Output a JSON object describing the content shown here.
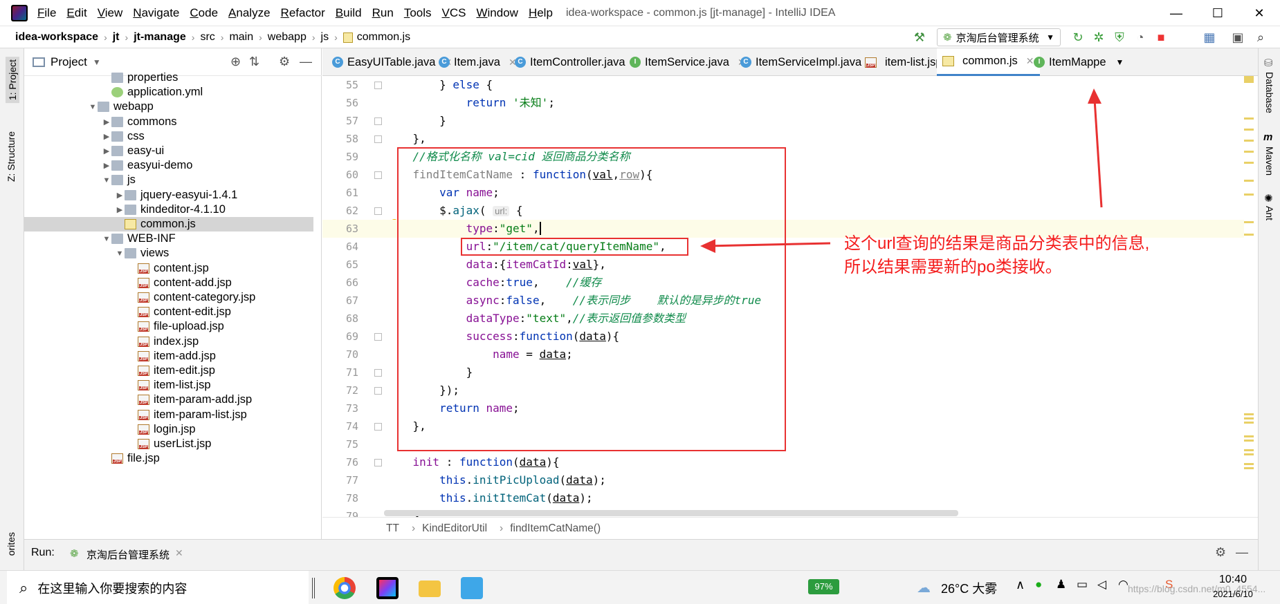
{
  "window": {
    "title": "idea-workspace - common.js [jt-manage] - IntelliJ IDEA",
    "menu": [
      "File",
      "Edit",
      "View",
      "Navigate",
      "Code",
      "Analyze",
      "Refactor",
      "Build",
      "Run",
      "Tools",
      "VCS",
      "Window",
      "Help"
    ],
    "controls": {
      "minimize": "—",
      "maximize": "☐",
      "close": "✕"
    }
  },
  "breadcrumb": [
    "idea-workspace",
    "jt",
    "jt-manage",
    "src",
    "main",
    "webapp",
    "js",
    "common.js"
  ],
  "run_config": "京淘后台管理系统",
  "left_strip": {
    "project": "1: Project",
    "structure": "Z: Structure",
    "favorites": "orites"
  },
  "right_strip": {
    "database": "Database",
    "maven": "Maven",
    "ant": "Ant"
  },
  "project_panel": {
    "title": "Project",
    "items": [
      {
        "label": "properties",
        "type": "folder",
        "indent": 1,
        "arrow": ""
      },
      {
        "label": "application.yml",
        "type": "yml",
        "indent": 1,
        "arrow": ""
      },
      {
        "label": "webapp",
        "type": "folder",
        "indent": 0,
        "arrow": "▼"
      },
      {
        "label": "commons",
        "type": "folder",
        "indent": 1,
        "arrow": "▶"
      },
      {
        "label": "css",
        "type": "folder",
        "indent": 1,
        "arrow": "▶"
      },
      {
        "label": "easy-ui",
        "type": "folder",
        "indent": 1,
        "arrow": "▶"
      },
      {
        "label": "easyui-demo",
        "type": "folder",
        "indent": 1,
        "arrow": "▶"
      },
      {
        "label": "js",
        "type": "folder",
        "indent": 1,
        "arrow": "▼"
      },
      {
        "label": "jquery-easyui-1.4.1",
        "type": "folder",
        "indent": 2,
        "arrow": "▶"
      },
      {
        "label": "kindeditor-4.1.10",
        "type": "folder",
        "indent": 2,
        "arrow": "▶"
      },
      {
        "label": "common.js",
        "type": "js",
        "indent": 2,
        "arrow": "",
        "selected": true
      },
      {
        "label": "WEB-INF",
        "type": "folder",
        "indent": 1,
        "arrow": "▼"
      },
      {
        "label": "views",
        "type": "folder",
        "indent": 2,
        "arrow": "▼"
      },
      {
        "label": "content.jsp",
        "type": "jsp",
        "indent": 3,
        "arrow": ""
      },
      {
        "label": "content-add.jsp",
        "type": "jsp",
        "indent": 3,
        "arrow": ""
      },
      {
        "label": "content-category.jsp",
        "type": "jsp",
        "indent": 3,
        "arrow": ""
      },
      {
        "label": "content-edit.jsp",
        "type": "jsp",
        "indent": 3,
        "arrow": ""
      },
      {
        "label": "file-upload.jsp",
        "type": "jsp",
        "indent": 3,
        "arrow": ""
      },
      {
        "label": "index.jsp",
        "type": "jsp",
        "indent": 3,
        "arrow": ""
      },
      {
        "label": "item-add.jsp",
        "type": "jsp",
        "indent": 3,
        "arrow": ""
      },
      {
        "label": "item-edit.jsp",
        "type": "jsp",
        "indent": 3,
        "arrow": ""
      },
      {
        "label": "item-list.jsp",
        "type": "jsp",
        "indent": 3,
        "arrow": ""
      },
      {
        "label": "item-param-add.jsp",
        "type": "jsp",
        "indent": 3,
        "arrow": ""
      },
      {
        "label": "item-param-list.jsp",
        "type": "jsp",
        "indent": 3,
        "arrow": ""
      },
      {
        "label": "login.jsp",
        "type": "jsp",
        "indent": 3,
        "arrow": ""
      },
      {
        "label": "userList.jsp",
        "type": "jsp",
        "indent": 3,
        "arrow": ""
      },
      {
        "label": "file.jsp",
        "type": "jsp",
        "indent": 1,
        "arrow": ""
      }
    ]
  },
  "tabs": [
    {
      "label": "EasyUITable.java",
      "icon": "C"
    },
    {
      "label": "Item.java",
      "icon": "C"
    },
    {
      "label": "ItemController.java",
      "icon": "C"
    },
    {
      "label": "ItemService.java",
      "icon": "I"
    },
    {
      "label": "ItemServiceImpl.java",
      "icon": "C"
    },
    {
      "label": "item-list.jsp",
      "icon": "JSP"
    },
    {
      "label": "common.js",
      "icon": "JS",
      "active": true
    },
    {
      "label": "ItemMappe",
      "icon": "I"
    }
  ],
  "editor": {
    "line_numbers": [
      "55",
      "56",
      "57",
      "58",
      "59",
      "60",
      "61",
      "62",
      "63",
      "64",
      "65",
      "66",
      "67",
      "68",
      "69",
      "70",
      "71",
      "72",
      "73",
      "74",
      "75",
      "76",
      "77",
      "78",
      "79"
    ],
    "current_line": "63",
    "param_hint": "url:",
    "comments": {
      "c59": "//格式化名称 val=cid 返回商品分类名称",
      "c66": "//缓存",
      "c67": "//表示同步    默认的是异步的true",
      "c68": "//表示返回值参数类型"
    },
    "strings": {
      "get": "\"get\"",
      "url": "\"/item/cat/queryItemName\"",
      "text": "\"text\"",
      "unknown": "'未知'"
    }
  },
  "annotation": {
    "line1": "这个url查询的结果是商品分类表中的信息,",
    "line2": "所以结果需要新的po类接收。",
    "color": "#f41c1c"
  },
  "editor_breadcrumb": [
    "TT",
    "KindEditorUtil",
    "findItemCatName()"
  ],
  "run_bar": {
    "label": "Run:",
    "config": "京淘后台管理系统"
  },
  "taskbar": {
    "search_placeholder": "在这里输入你要搜索的内容",
    "battery": "97%",
    "weather": "26°C 大雾",
    "time": "10:40",
    "date": "2021/6/10",
    "watermark": "https://blog.csdn.net/m0_4554..."
  }
}
